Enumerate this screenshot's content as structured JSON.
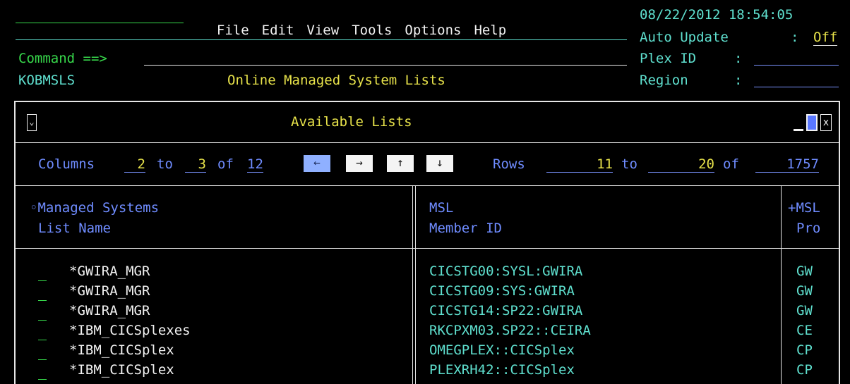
{
  "menu": {
    "items": [
      "File",
      "Edit",
      "View",
      "Tools",
      "Options",
      "Help"
    ],
    "datetime": "08/22/2012 18:54:05"
  },
  "header": {
    "auto_update_label": "Auto Update",
    "auto_update_sep": ":",
    "auto_update_value": "Off",
    "command_label": "Command ==>",
    "command_value": "",
    "plex_id_label": "Plex ID",
    "plex_id_sep": ":",
    "plex_id_value": "",
    "region_label": "Region",
    "region_sep": ":",
    "region_value": "",
    "panel_id": "KOBMSLS",
    "title": "Online Managed System Lists"
  },
  "popup": {
    "title": "Available Lists",
    "menu_icon": "dropdown-menu-icon",
    "window_controls": [
      "minimize-icon",
      "maximize-icon",
      "close-icon"
    ],
    "columns_label": "Columns",
    "columns_from": "2",
    "columns_to_word": "to",
    "columns_to": "3",
    "columns_of_word": "of",
    "columns_total": "12",
    "nav_buttons": [
      "←",
      "→",
      "↑",
      "↓"
    ],
    "rows_label": "Rows",
    "rows_from": "11",
    "rows_to_word": "to",
    "rows_to": "20",
    "rows_of_word": "of",
    "rows_total": "1757",
    "col1_header_line1": "◦Managed Systems",
    "col1_header_line2": "List Name",
    "col2_header_line1": "MSL",
    "col2_header_line2": "Member ID",
    "col3_header_line1": "+MSL",
    "col3_header_line2": "Pro",
    "rows": [
      {
        "sel": "_",
        "name": "*GWIRA_MGR",
        "member": "CICSTG00:SYSL:GWIRA",
        "pro": "GW"
      },
      {
        "sel": "_",
        "name": "*GWIRA_MGR",
        "member": "CICSTG09:SYS:GWIRA",
        "pro": "GW"
      },
      {
        "sel": "_",
        "name": "*GWIRA_MGR",
        "member": "CICSTG14:SP22:GWIRA",
        "pro": "GW"
      },
      {
        "sel": "_",
        "name": "*IBM_CICSplexes",
        "member": "RKCPXM03.SP22::CEIRA",
        "pro": "CE"
      },
      {
        "sel": "_",
        "name": "*IBM_CICSplex",
        "member": "OMEGPLEX::CICSplex",
        "pro": "CP"
      },
      {
        "sel": "_",
        "name": "*IBM_CICSplex",
        "member": "PLEXRH42::CICSplex",
        "pro": "CP"
      }
    ]
  }
}
